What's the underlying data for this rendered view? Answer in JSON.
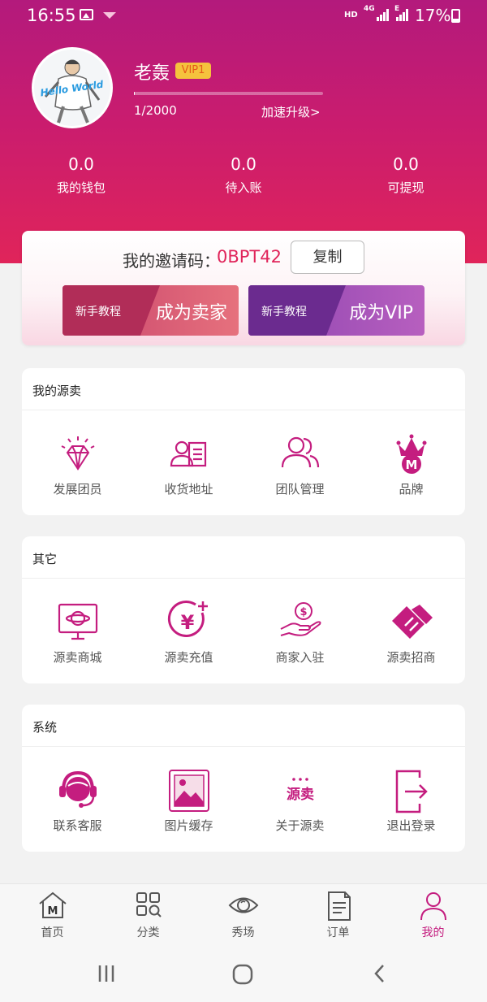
{
  "status_bar": {
    "time": "16:55",
    "hd": "HD",
    "network": "4G",
    "network2": "E",
    "battery": "17%"
  },
  "profile": {
    "name": "老轰",
    "vip_level": "VIP1",
    "avatar_text": "Hello World",
    "progress_fraction": 0.0005,
    "progress_text": "1/2000",
    "upgrade_link": "加速升级>"
  },
  "stats": [
    {
      "value": "0.0",
      "label": "我的钱包"
    },
    {
      "value": "0.0",
      "label": "待入账"
    },
    {
      "value": "0.0",
      "label": "可提现"
    }
  ],
  "invite": {
    "label": "我的邀请码：",
    "code": "0BPT42",
    "copy_label": "复制"
  },
  "promos": [
    {
      "small": "新手教程",
      "big": "成为卖家"
    },
    {
      "small": "新手教程",
      "big": "成为VIP"
    }
  ],
  "sections": [
    {
      "title": "我的源卖",
      "items": [
        {
          "label": "发展团员",
          "icon": "diamond-icon"
        },
        {
          "label": "收货地址",
          "icon": "address-card-icon"
        },
        {
          "label": "团队管理",
          "icon": "team-icon"
        },
        {
          "label": "品牌",
          "icon": "brand-crown-icon"
        }
      ]
    },
    {
      "title": "其它",
      "items": [
        {
          "label": "源卖商城",
          "icon": "mall-monitor-icon"
        },
        {
          "label": "源卖充值",
          "icon": "yuan-recharge-icon"
        },
        {
          "label": "商家入驻",
          "icon": "hand-coin-icon"
        },
        {
          "label": "源卖招商",
          "icon": "handshake-icon"
        }
      ]
    },
    {
      "title": "系统",
      "items": [
        {
          "label": "联系客服",
          "icon": "headset-service-icon"
        },
        {
          "label": "图片缓存",
          "icon": "image-cache-icon"
        },
        {
          "label": "关于源卖",
          "icon": "about-logo-icon",
          "logo_text": "源卖"
        },
        {
          "label": "退出登录",
          "icon": "logout-icon"
        }
      ]
    }
  ],
  "tabs": [
    {
      "label": "首页",
      "icon": "home-icon",
      "glyph": "M"
    },
    {
      "label": "分类",
      "icon": "category-icon"
    },
    {
      "label": "秀场",
      "icon": "eye-icon"
    },
    {
      "label": "订单",
      "icon": "order-icon"
    },
    {
      "label": "我的",
      "icon": "profile-icon",
      "active": true
    }
  ],
  "colors": {
    "accent": "#c41d7f",
    "header_top": "#b31a7c",
    "header_bottom": "#e0245a",
    "vip_badge": "#f5c23d"
  }
}
